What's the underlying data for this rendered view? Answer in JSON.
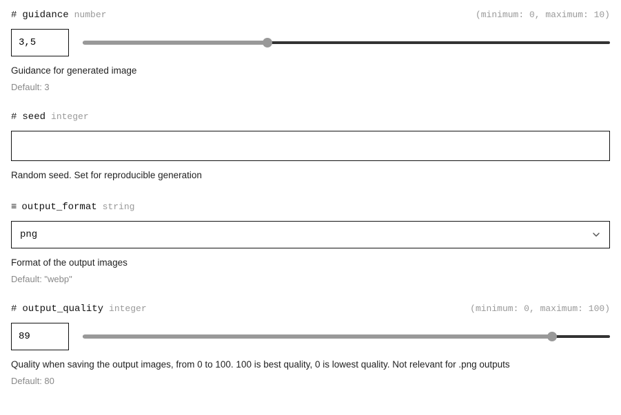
{
  "fields": {
    "guidance": {
      "icon": "#",
      "name": "guidance",
      "type": "number",
      "range": "(minimum: 0, maximum: 10)",
      "value": "3,5",
      "slider_percent": 35,
      "desc": "Guidance for generated image",
      "default": "Default: 3"
    },
    "seed": {
      "icon": "#",
      "name": "seed",
      "type": "integer",
      "value": "",
      "desc": "Random seed. Set for reproducible generation"
    },
    "output_format": {
      "icon": "≡",
      "name": "output_format",
      "type": "string",
      "value": "png",
      "desc": "Format of the output images",
      "default": "Default: \"webp\""
    },
    "output_quality": {
      "icon": "#",
      "name": "output_quality",
      "type": "integer",
      "range": "(minimum: 0, maximum: 100)",
      "value": "89",
      "slider_percent": 89,
      "desc": "Quality when saving the output images, from 0 to 100. 100 is best quality, 0 is lowest quality. Not relevant for .png outputs",
      "default": "Default: 80"
    }
  }
}
